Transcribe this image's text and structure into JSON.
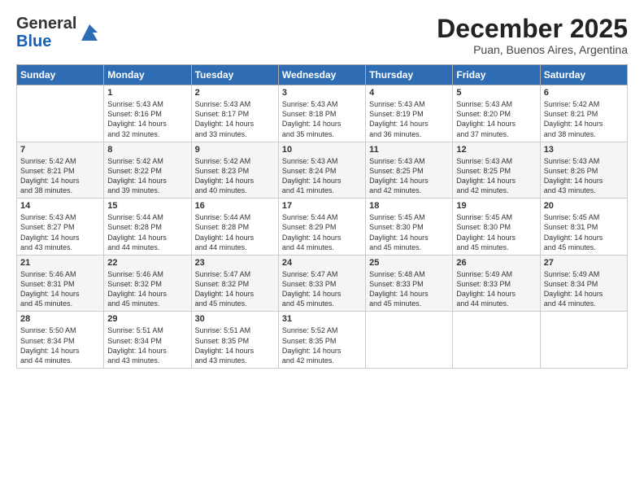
{
  "logo": {
    "general": "General",
    "blue": "Blue"
  },
  "header": {
    "month": "December 2025",
    "location": "Puan, Buenos Aires, Argentina"
  },
  "days_of_week": [
    "Sunday",
    "Monday",
    "Tuesday",
    "Wednesday",
    "Thursday",
    "Friday",
    "Saturday"
  ],
  "weeks": [
    [
      {
        "day": "",
        "sunrise": "",
        "sunset": "",
        "daylight": ""
      },
      {
        "day": "1",
        "sunrise": "Sunrise: 5:43 AM",
        "sunset": "Sunset: 8:16 PM",
        "daylight": "Daylight: 14 hours and 32 minutes."
      },
      {
        "day": "2",
        "sunrise": "Sunrise: 5:43 AM",
        "sunset": "Sunset: 8:17 PM",
        "daylight": "Daylight: 14 hours and 33 minutes."
      },
      {
        "day": "3",
        "sunrise": "Sunrise: 5:43 AM",
        "sunset": "Sunset: 8:18 PM",
        "daylight": "Daylight: 14 hours and 35 minutes."
      },
      {
        "day": "4",
        "sunrise": "Sunrise: 5:43 AM",
        "sunset": "Sunset: 8:19 PM",
        "daylight": "Daylight: 14 hours and 36 minutes."
      },
      {
        "day": "5",
        "sunrise": "Sunrise: 5:43 AM",
        "sunset": "Sunset: 8:20 PM",
        "daylight": "Daylight: 14 hours and 37 minutes."
      },
      {
        "day": "6",
        "sunrise": "Sunrise: 5:42 AM",
        "sunset": "Sunset: 8:21 PM",
        "daylight": "Daylight: 14 hours and 38 minutes."
      }
    ],
    [
      {
        "day": "7",
        "sunrise": "Sunrise: 5:42 AM",
        "sunset": "Sunset: 8:21 PM",
        "daylight": "Daylight: 14 hours and 38 minutes."
      },
      {
        "day": "8",
        "sunrise": "Sunrise: 5:42 AM",
        "sunset": "Sunset: 8:22 PM",
        "daylight": "Daylight: 14 hours and 39 minutes."
      },
      {
        "day": "9",
        "sunrise": "Sunrise: 5:42 AM",
        "sunset": "Sunset: 8:23 PM",
        "daylight": "Daylight: 14 hours and 40 minutes."
      },
      {
        "day": "10",
        "sunrise": "Sunrise: 5:43 AM",
        "sunset": "Sunset: 8:24 PM",
        "daylight": "Daylight: 14 hours and 41 minutes."
      },
      {
        "day": "11",
        "sunrise": "Sunrise: 5:43 AM",
        "sunset": "Sunset: 8:25 PM",
        "daylight": "Daylight: 14 hours and 42 minutes."
      },
      {
        "day": "12",
        "sunrise": "Sunrise: 5:43 AM",
        "sunset": "Sunset: 8:25 PM",
        "daylight": "Daylight: 14 hours and 42 minutes."
      },
      {
        "day": "13",
        "sunrise": "Sunrise: 5:43 AM",
        "sunset": "Sunset: 8:26 PM",
        "daylight": "Daylight: 14 hours and 43 minutes."
      }
    ],
    [
      {
        "day": "14",
        "sunrise": "Sunrise: 5:43 AM",
        "sunset": "Sunset: 8:27 PM",
        "daylight": "Daylight: 14 hours and 43 minutes."
      },
      {
        "day": "15",
        "sunrise": "Sunrise: 5:44 AM",
        "sunset": "Sunset: 8:28 PM",
        "daylight": "Daylight: 14 hours and 44 minutes."
      },
      {
        "day": "16",
        "sunrise": "Sunrise: 5:44 AM",
        "sunset": "Sunset: 8:28 PM",
        "daylight": "Daylight: 14 hours and 44 minutes."
      },
      {
        "day": "17",
        "sunrise": "Sunrise: 5:44 AM",
        "sunset": "Sunset: 8:29 PM",
        "daylight": "Daylight: 14 hours and 44 minutes."
      },
      {
        "day": "18",
        "sunrise": "Sunrise: 5:45 AM",
        "sunset": "Sunset: 8:30 PM",
        "daylight": "Daylight: 14 hours and 45 minutes."
      },
      {
        "day": "19",
        "sunrise": "Sunrise: 5:45 AM",
        "sunset": "Sunset: 8:30 PM",
        "daylight": "Daylight: 14 hours and 45 minutes."
      },
      {
        "day": "20",
        "sunrise": "Sunrise: 5:45 AM",
        "sunset": "Sunset: 8:31 PM",
        "daylight": "Daylight: 14 hours and 45 minutes."
      }
    ],
    [
      {
        "day": "21",
        "sunrise": "Sunrise: 5:46 AM",
        "sunset": "Sunset: 8:31 PM",
        "daylight": "Daylight: 14 hours and 45 minutes."
      },
      {
        "day": "22",
        "sunrise": "Sunrise: 5:46 AM",
        "sunset": "Sunset: 8:32 PM",
        "daylight": "Daylight: 14 hours and 45 minutes."
      },
      {
        "day": "23",
        "sunrise": "Sunrise: 5:47 AM",
        "sunset": "Sunset: 8:32 PM",
        "daylight": "Daylight: 14 hours and 45 minutes."
      },
      {
        "day": "24",
        "sunrise": "Sunrise: 5:47 AM",
        "sunset": "Sunset: 8:33 PM",
        "daylight": "Daylight: 14 hours and 45 minutes."
      },
      {
        "day": "25",
        "sunrise": "Sunrise: 5:48 AM",
        "sunset": "Sunset: 8:33 PM",
        "daylight": "Daylight: 14 hours and 45 minutes."
      },
      {
        "day": "26",
        "sunrise": "Sunrise: 5:49 AM",
        "sunset": "Sunset: 8:33 PM",
        "daylight": "Daylight: 14 hours and 44 minutes."
      },
      {
        "day": "27",
        "sunrise": "Sunrise: 5:49 AM",
        "sunset": "Sunset: 8:34 PM",
        "daylight": "Daylight: 14 hours and 44 minutes."
      }
    ],
    [
      {
        "day": "28",
        "sunrise": "Sunrise: 5:50 AM",
        "sunset": "Sunset: 8:34 PM",
        "daylight": "Daylight: 14 hours and 44 minutes."
      },
      {
        "day": "29",
        "sunrise": "Sunrise: 5:51 AM",
        "sunset": "Sunset: 8:34 PM",
        "daylight": "Daylight: 14 hours and 43 minutes."
      },
      {
        "day": "30",
        "sunrise": "Sunrise: 5:51 AM",
        "sunset": "Sunset: 8:35 PM",
        "daylight": "Daylight: 14 hours and 43 minutes."
      },
      {
        "day": "31",
        "sunrise": "Sunrise: 5:52 AM",
        "sunset": "Sunset: 8:35 PM",
        "daylight": "Daylight: 14 hours and 42 minutes."
      },
      {
        "day": "",
        "sunrise": "",
        "sunset": "",
        "daylight": ""
      },
      {
        "day": "",
        "sunrise": "",
        "sunset": "",
        "daylight": ""
      },
      {
        "day": "",
        "sunrise": "",
        "sunset": "",
        "daylight": ""
      }
    ]
  ]
}
